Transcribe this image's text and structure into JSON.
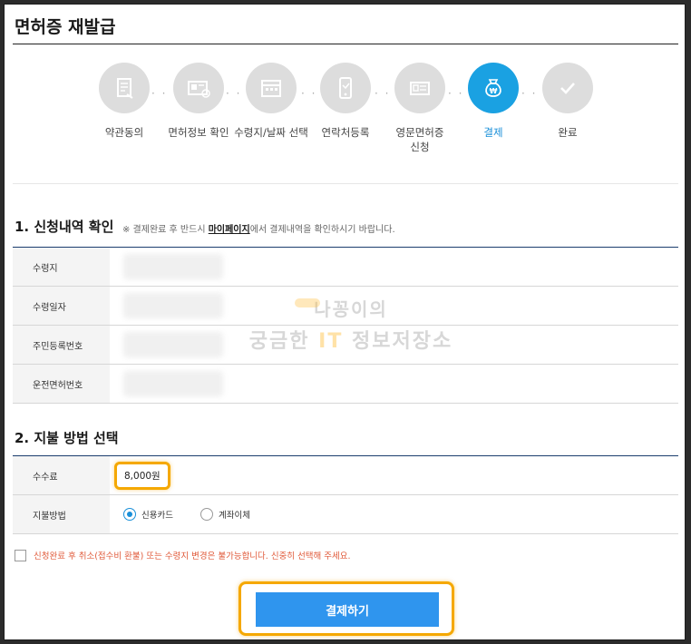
{
  "page": {
    "title": "면허증 재발급"
  },
  "steps": [
    {
      "label": "약관동의",
      "icon": "document-icon",
      "active": false
    },
    {
      "label": "면허정보 확인",
      "icon": "id-card-icon",
      "active": false
    },
    {
      "label": "수령지/날짜 선택",
      "icon": "calendar-icon",
      "active": false
    },
    {
      "label": "연락처등록",
      "icon": "phone-icon",
      "active": false
    },
    {
      "label_line1": "영문면허증",
      "label_line2": "신청",
      "icon": "license-icon",
      "active": false
    },
    {
      "label": "결제",
      "icon": "payment-bag-icon",
      "active": true
    },
    {
      "label": "완료",
      "icon": "check-icon",
      "active": false
    }
  ],
  "section1": {
    "title": "1. 신청내역 확인",
    "note_prefix": "※ 결제완료 후 반드시 ",
    "note_highlight": "마이페이지",
    "note_suffix": "에서 결제내역을 확인하시기 바랍니다.",
    "rows": [
      {
        "label": "수령지"
      },
      {
        "label": "수령일자"
      },
      {
        "label": "주민등록번호"
      },
      {
        "label": "운전면허번호"
      }
    ]
  },
  "section2": {
    "title": "2. 지불 방법 선택",
    "fee_label": "수수료",
    "fee_value": "8,000원",
    "method_label": "지불방법",
    "options": [
      {
        "label": "신용카드",
        "checked": true
      },
      {
        "label": "계좌이체",
        "checked": false
      }
    ]
  },
  "agreement": {
    "text": "신청완료 후 취소(접수비 환불) 또는 수령지 변경은 불가능합니다. 신중히 선택해 주세요."
  },
  "watermark": {
    "line1": "나꽁이의",
    "line2_a": "궁금한 ",
    "line2_it": "IT",
    "line2_b": " 정보저장소"
  },
  "pay_button": {
    "label": "결제하기"
  },
  "colors": {
    "accent": "#1aa1e2",
    "button": "#2f95ee",
    "highlight": "#f5a800",
    "warning": "#e05a3a"
  }
}
